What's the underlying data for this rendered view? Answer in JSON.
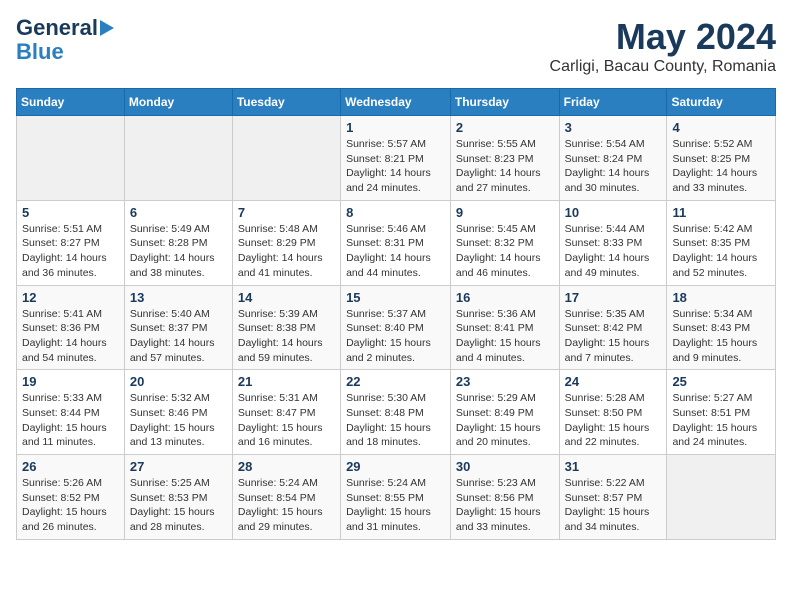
{
  "header": {
    "logo_line1": "General",
    "logo_line2": "Blue",
    "title": "May 2024",
    "subtitle": "Carligi, Bacau County, Romania"
  },
  "weekdays": [
    "Sunday",
    "Monday",
    "Tuesday",
    "Wednesday",
    "Thursday",
    "Friday",
    "Saturday"
  ],
  "weeks": [
    [
      {
        "day": "",
        "info": ""
      },
      {
        "day": "",
        "info": ""
      },
      {
        "day": "",
        "info": ""
      },
      {
        "day": "1",
        "info": "Sunrise: 5:57 AM\nSunset: 8:21 PM\nDaylight: 14 hours\nand 24 minutes."
      },
      {
        "day": "2",
        "info": "Sunrise: 5:55 AM\nSunset: 8:23 PM\nDaylight: 14 hours\nand 27 minutes."
      },
      {
        "day": "3",
        "info": "Sunrise: 5:54 AM\nSunset: 8:24 PM\nDaylight: 14 hours\nand 30 minutes."
      },
      {
        "day": "4",
        "info": "Sunrise: 5:52 AM\nSunset: 8:25 PM\nDaylight: 14 hours\nand 33 minutes."
      }
    ],
    [
      {
        "day": "5",
        "info": "Sunrise: 5:51 AM\nSunset: 8:27 PM\nDaylight: 14 hours\nand 36 minutes."
      },
      {
        "day": "6",
        "info": "Sunrise: 5:49 AM\nSunset: 8:28 PM\nDaylight: 14 hours\nand 38 minutes."
      },
      {
        "day": "7",
        "info": "Sunrise: 5:48 AM\nSunset: 8:29 PM\nDaylight: 14 hours\nand 41 minutes."
      },
      {
        "day": "8",
        "info": "Sunrise: 5:46 AM\nSunset: 8:31 PM\nDaylight: 14 hours\nand 44 minutes."
      },
      {
        "day": "9",
        "info": "Sunrise: 5:45 AM\nSunset: 8:32 PM\nDaylight: 14 hours\nand 46 minutes."
      },
      {
        "day": "10",
        "info": "Sunrise: 5:44 AM\nSunset: 8:33 PM\nDaylight: 14 hours\nand 49 minutes."
      },
      {
        "day": "11",
        "info": "Sunrise: 5:42 AM\nSunset: 8:35 PM\nDaylight: 14 hours\nand 52 minutes."
      }
    ],
    [
      {
        "day": "12",
        "info": "Sunrise: 5:41 AM\nSunset: 8:36 PM\nDaylight: 14 hours\nand 54 minutes."
      },
      {
        "day": "13",
        "info": "Sunrise: 5:40 AM\nSunset: 8:37 PM\nDaylight: 14 hours\nand 57 minutes."
      },
      {
        "day": "14",
        "info": "Sunrise: 5:39 AM\nSunset: 8:38 PM\nDaylight: 14 hours\nand 59 minutes."
      },
      {
        "day": "15",
        "info": "Sunrise: 5:37 AM\nSunset: 8:40 PM\nDaylight: 15 hours\nand 2 minutes."
      },
      {
        "day": "16",
        "info": "Sunrise: 5:36 AM\nSunset: 8:41 PM\nDaylight: 15 hours\nand 4 minutes."
      },
      {
        "day": "17",
        "info": "Sunrise: 5:35 AM\nSunset: 8:42 PM\nDaylight: 15 hours\nand 7 minutes."
      },
      {
        "day": "18",
        "info": "Sunrise: 5:34 AM\nSunset: 8:43 PM\nDaylight: 15 hours\nand 9 minutes."
      }
    ],
    [
      {
        "day": "19",
        "info": "Sunrise: 5:33 AM\nSunset: 8:44 PM\nDaylight: 15 hours\nand 11 minutes."
      },
      {
        "day": "20",
        "info": "Sunrise: 5:32 AM\nSunset: 8:46 PM\nDaylight: 15 hours\nand 13 minutes."
      },
      {
        "day": "21",
        "info": "Sunrise: 5:31 AM\nSunset: 8:47 PM\nDaylight: 15 hours\nand 16 minutes."
      },
      {
        "day": "22",
        "info": "Sunrise: 5:30 AM\nSunset: 8:48 PM\nDaylight: 15 hours\nand 18 minutes."
      },
      {
        "day": "23",
        "info": "Sunrise: 5:29 AM\nSunset: 8:49 PM\nDaylight: 15 hours\nand 20 minutes."
      },
      {
        "day": "24",
        "info": "Sunrise: 5:28 AM\nSunset: 8:50 PM\nDaylight: 15 hours\nand 22 minutes."
      },
      {
        "day": "25",
        "info": "Sunrise: 5:27 AM\nSunset: 8:51 PM\nDaylight: 15 hours\nand 24 minutes."
      }
    ],
    [
      {
        "day": "26",
        "info": "Sunrise: 5:26 AM\nSunset: 8:52 PM\nDaylight: 15 hours\nand 26 minutes."
      },
      {
        "day": "27",
        "info": "Sunrise: 5:25 AM\nSunset: 8:53 PM\nDaylight: 15 hours\nand 28 minutes."
      },
      {
        "day": "28",
        "info": "Sunrise: 5:24 AM\nSunset: 8:54 PM\nDaylight: 15 hours\nand 29 minutes."
      },
      {
        "day": "29",
        "info": "Sunrise: 5:24 AM\nSunset: 8:55 PM\nDaylight: 15 hours\nand 31 minutes."
      },
      {
        "day": "30",
        "info": "Sunrise: 5:23 AM\nSunset: 8:56 PM\nDaylight: 15 hours\nand 33 minutes."
      },
      {
        "day": "31",
        "info": "Sunrise: 5:22 AM\nSunset: 8:57 PM\nDaylight: 15 hours\nand 34 minutes."
      },
      {
        "day": "",
        "info": ""
      }
    ]
  ]
}
